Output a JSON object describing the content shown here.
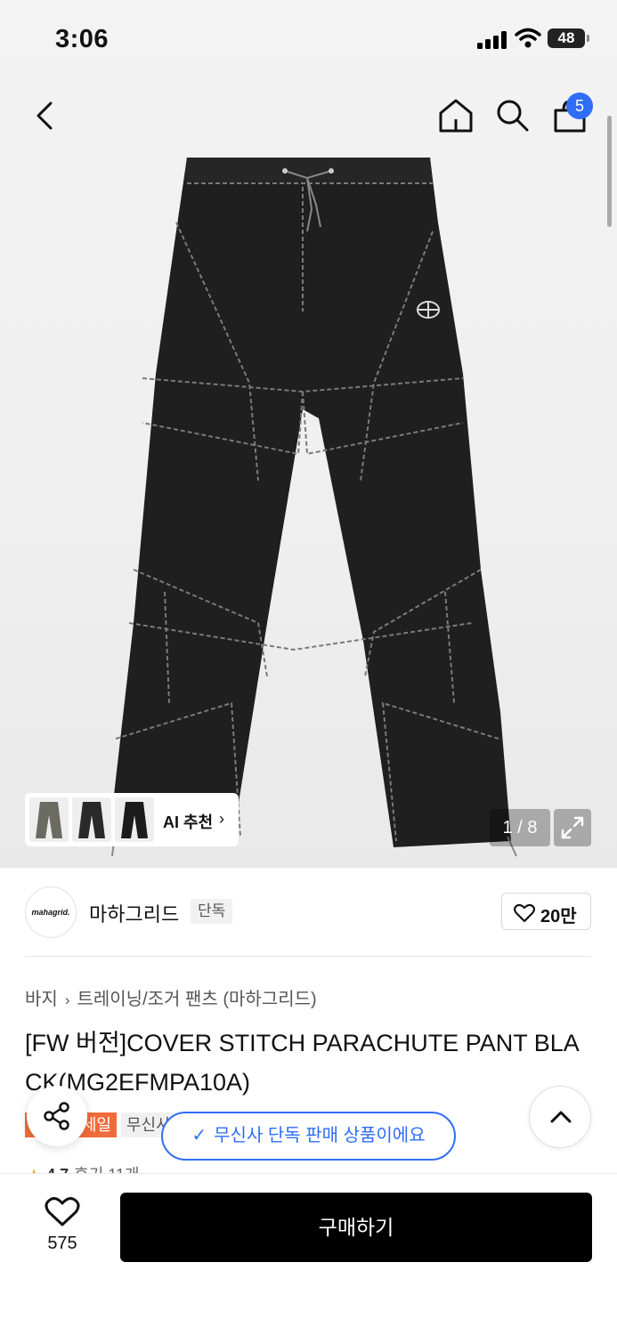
{
  "status_bar": {
    "time": "3:06",
    "battery": "48"
  },
  "nav": {
    "cart_count": "5",
    "back_icon": "chevron-left-icon",
    "home_icon": "home-icon",
    "search_icon": "search-icon",
    "cart_icon": "shopping-bag-icon"
  },
  "gallery": {
    "counter": "1 / 8",
    "ai_label": "AI 추천",
    "ai_chevron": "›",
    "thumb_colors": [
      "#6b6b62",
      "#2a2a2a",
      "#1c1c1c"
    ]
  },
  "brand": {
    "logo_text": "mahagrid.",
    "name": "마하그리드",
    "tag": "단독",
    "likes": "20만"
  },
  "breadcrumb": {
    "level1": "바지",
    "separator": "›",
    "level2": "트레이닝/조거 팬츠 (마하그리드)"
  },
  "product": {
    "title": "[FW 버전]COVER STITCH PARACHUTE PANT BLACK(MG2EFMPA10A)"
  },
  "tags": {
    "sale": "세일",
    "exclusive": "무신사"
  },
  "toast": {
    "check": "✓",
    "message": "무신사 단독 판매 상품이에요"
  },
  "rating": {
    "star": "★",
    "score": "4.7",
    "reviews": "후기 11개"
  },
  "bottom_bar": {
    "favorites": "575",
    "buy_label": "구매하기"
  },
  "colors": {
    "accent": "#2f6df6",
    "sale": "#f26b3a",
    "buy_button": "#000000"
  }
}
